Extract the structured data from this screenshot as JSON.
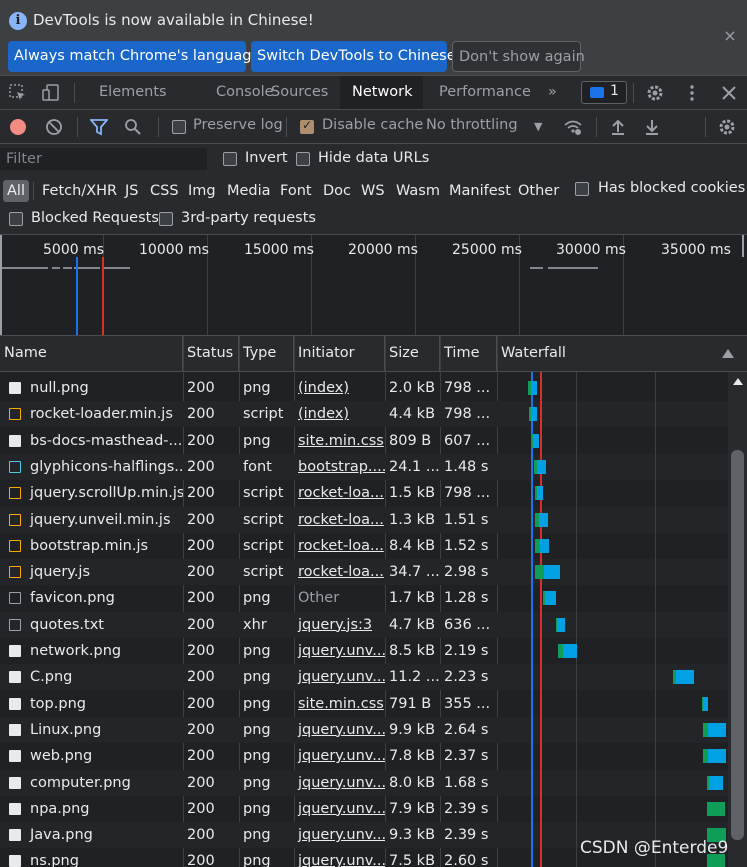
{
  "infobar": {
    "message": "DevTools is now available in Chinese!",
    "btn_always": "Always match Chrome's language",
    "btn_switch": "Switch DevTools to Chinese",
    "btn_dont": "Don't show again",
    "close": "×"
  },
  "tabs": [
    {
      "label": "Elements"
    },
    {
      "label": "Console"
    },
    {
      "label": "Sources"
    },
    {
      "label": "Network"
    },
    {
      "label": "Performance"
    }
  ],
  "tabs_more": "»",
  "issues_count": "1",
  "toolbar": {
    "preserve_log": "Preserve log",
    "preserve_log_checked": false,
    "disable_cache": "Disable cache",
    "disable_cache_checked": true,
    "throttling": "No throttling"
  },
  "filter": {
    "placeholder": "Filter",
    "invert": "Invert",
    "hide_data_urls": "Hide data URLs"
  },
  "type_filters": [
    "All",
    "Fetch/XHR",
    "JS",
    "CSS",
    "Img",
    "Media",
    "Font",
    "Doc",
    "WS",
    "Wasm",
    "Manifest",
    "Other"
  ],
  "type_active": "All",
  "has_blocked_cookies": "Has blocked cookies",
  "blocked_requests": "Blocked Requests",
  "third_party": "3rd-party requests",
  "overview_labels": [
    "5000 ms",
    "10000 ms",
    "15000 ms",
    "20000 ms",
    "25000 ms",
    "30000 ms",
    "35000 ms"
  ],
  "columns": {
    "name": "Name",
    "status": "Status",
    "type": "Type",
    "initiator": "Initiator",
    "size": "Size",
    "time": "Time",
    "waterfall": "Waterfall"
  },
  "rows": [
    {
      "name": "null.png",
      "status": "200",
      "type": "png",
      "initiator": "(index)",
      "size": "2.0 kB",
      "time": "798 ...",
      "icon": "image-icon"
    },
    {
      "name": "rocket-loader.min.js",
      "status": "200",
      "type": "script",
      "initiator": "(index)",
      "size": "4.4 kB",
      "time": "798 ...",
      "icon": "script-icon"
    },
    {
      "name": "bs-docs-masthead-...",
      "status": "200",
      "type": "png",
      "initiator": "site.min.css",
      "size": "809 B",
      "time": "607 ...",
      "icon": "image-icon"
    },
    {
      "name": "glyphicons-halflings...",
      "status": "200",
      "type": "font",
      "initiator": "bootstrap....",
      "size": "24.1 ...",
      "time": "1.48 s",
      "icon": "font-icon"
    },
    {
      "name": "jquery.scrollUp.min.js",
      "status": "200",
      "type": "script",
      "initiator": "rocket-loa...",
      "size": "1.5 kB",
      "time": "798 ...",
      "icon": "script-icon"
    },
    {
      "name": "jquery.unveil.min.js",
      "status": "200",
      "type": "script",
      "initiator": "rocket-loa...",
      "size": "1.3 kB",
      "time": "1.51 s",
      "icon": "script-icon"
    },
    {
      "name": "bootstrap.min.js",
      "status": "200",
      "type": "script",
      "initiator": "rocket-loa...",
      "size": "8.4 kB",
      "time": "1.52 s",
      "icon": "script-icon"
    },
    {
      "name": "jquery.js",
      "status": "200",
      "type": "script",
      "initiator": "rocket-loa...",
      "size": "34.7 ...",
      "time": "2.98 s",
      "icon": "script-icon"
    },
    {
      "name": "favicon.png",
      "status": "200",
      "type": "png",
      "initiator": "Other",
      "size": "1.7 kB",
      "time": "1.28 s",
      "icon": "document-icon"
    },
    {
      "name": "quotes.txt",
      "status": "200",
      "type": "xhr",
      "initiator": "jquery.js:3",
      "size": "4.7 kB",
      "time": "636 ...",
      "icon": "document-icon"
    },
    {
      "name": "network.png",
      "status": "200",
      "type": "png",
      "initiator": "jquery.unv...",
      "size": "8.5 kB",
      "time": "2.19 s",
      "icon": "image-icon"
    },
    {
      "name": "C.png",
      "status": "200",
      "type": "png",
      "initiator": "jquery.unv...",
      "size": "11.2 ...",
      "time": "2.23 s",
      "icon": "image-icon"
    },
    {
      "name": "top.png",
      "status": "200",
      "type": "png",
      "initiator": "site.min.css",
      "size": "791 B",
      "time": "355 ...",
      "icon": "image-icon"
    },
    {
      "name": "Linux.png",
      "status": "200",
      "type": "png",
      "initiator": "jquery.unv...",
      "size": "9.9 kB",
      "time": "2.64 s",
      "icon": "image-icon"
    },
    {
      "name": "web.png",
      "status": "200",
      "type": "png",
      "initiator": "jquery.unv...",
      "size": "7.8 kB",
      "time": "2.37 s",
      "icon": "image-icon"
    },
    {
      "name": "computer.png",
      "status": "200",
      "type": "png",
      "initiator": "jquery.unv...",
      "size": "8.0 kB",
      "time": "1.68 s",
      "icon": "image-icon"
    },
    {
      "name": "npa.png",
      "status": "200",
      "type": "png",
      "initiator": "jquery.unv...",
      "size": "7.9 kB",
      "time": "2.39 s",
      "icon": "image-icon"
    },
    {
      "name": "Java.png",
      "status": "200",
      "type": "png",
      "initiator": "jquery.unv...",
      "size": "9.3 kB",
      "time": "2.39 s",
      "icon": "image-icon"
    },
    {
      "name": "ns.png",
      "status": "200",
      "type": "png",
      "initiator": "jquery.unv...",
      "size": "7.5 kB",
      "time": "2.60 s",
      "icon": "image-icon"
    }
  ],
  "watermark": "CSDN @Enterde9",
  "colors": {
    "accent_blue": "#1a73e8",
    "record_red": "#f28b82",
    "waterfall_waiting": "#00a0e4",
    "waterfall_download": "#0f9d58",
    "domcontentloaded_line": "#1a73e8",
    "load_line": "#d93025"
  }
}
